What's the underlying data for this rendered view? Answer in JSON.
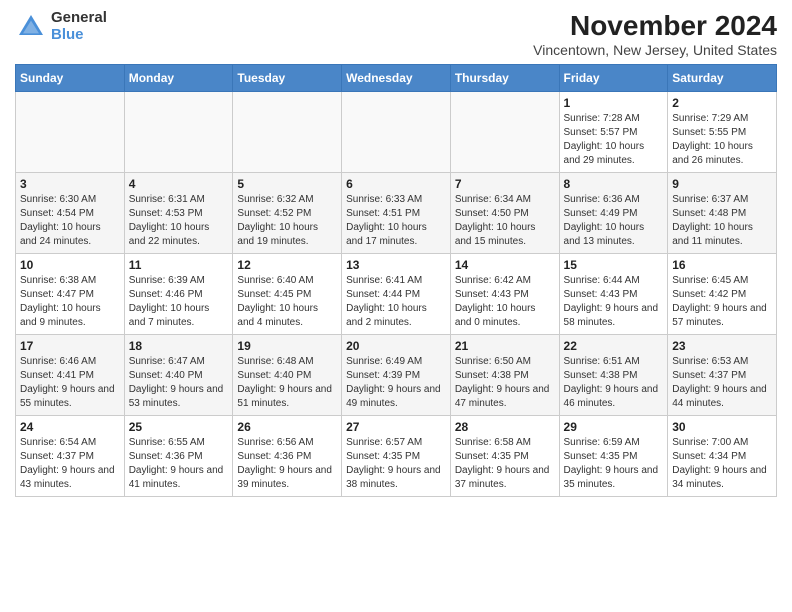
{
  "header": {
    "logo_general": "General",
    "logo_blue": "Blue",
    "title": "November 2024",
    "subtitle": "Vincentown, New Jersey, United States"
  },
  "days_of_week": [
    "Sunday",
    "Monday",
    "Tuesday",
    "Wednesday",
    "Thursday",
    "Friday",
    "Saturday"
  ],
  "weeks": [
    [
      {
        "day": "",
        "info": ""
      },
      {
        "day": "",
        "info": ""
      },
      {
        "day": "",
        "info": ""
      },
      {
        "day": "",
        "info": ""
      },
      {
        "day": "",
        "info": ""
      },
      {
        "day": "1",
        "info": "Sunrise: 7:28 AM\nSunset: 5:57 PM\nDaylight: 10 hours and 29 minutes."
      },
      {
        "day": "2",
        "info": "Sunrise: 7:29 AM\nSunset: 5:55 PM\nDaylight: 10 hours and 26 minutes."
      }
    ],
    [
      {
        "day": "3",
        "info": "Sunrise: 6:30 AM\nSunset: 4:54 PM\nDaylight: 10 hours and 24 minutes."
      },
      {
        "day": "4",
        "info": "Sunrise: 6:31 AM\nSunset: 4:53 PM\nDaylight: 10 hours and 22 minutes."
      },
      {
        "day": "5",
        "info": "Sunrise: 6:32 AM\nSunset: 4:52 PM\nDaylight: 10 hours and 19 minutes."
      },
      {
        "day": "6",
        "info": "Sunrise: 6:33 AM\nSunset: 4:51 PM\nDaylight: 10 hours and 17 minutes."
      },
      {
        "day": "7",
        "info": "Sunrise: 6:34 AM\nSunset: 4:50 PM\nDaylight: 10 hours and 15 minutes."
      },
      {
        "day": "8",
        "info": "Sunrise: 6:36 AM\nSunset: 4:49 PM\nDaylight: 10 hours and 13 minutes."
      },
      {
        "day": "9",
        "info": "Sunrise: 6:37 AM\nSunset: 4:48 PM\nDaylight: 10 hours and 11 minutes."
      }
    ],
    [
      {
        "day": "10",
        "info": "Sunrise: 6:38 AM\nSunset: 4:47 PM\nDaylight: 10 hours and 9 minutes."
      },
      {
        "day": "11",
        "info": "Sunrise: 6:39 AM\nSunset: 4:46 PM\nDaylight: 10 hours and 7 minutes."
      },
      {
        "day": "12",
        "info": "Sunrise: 6:40 AM\nSunset: 4:45 PM\nDaylight: 10 hours and 4 minutes."
      },
      {
        "day": "13",
        "info": "Sunrise: 6:41 AM\nSunset: 4:44 PM\nDaylight: 10 hours and 2 minutes."
      },
      {
        "day": "14",
        "info": "Sunrise: 6:42 AM\nSunset: 4:43 PM\nDaylight: 10 hours and 0 minutes."
      },
      {
        "day": "15",
        "info": "Sunrise: 6:44 AM\nSunset: 4:43 PM\nDaylight: 9 hours and 58 minutes."
      },
      {
        "day": "16",
        "info": "Sunrise: 6:45 AM\nSunset: 4:42 PM\nDaylight: 9 hours and 57 minutes."
      }
    ],
    [
      {
        "day": "17",
        "info": "Sunrise: 6:46 AM\nSunset: 4:41 PM\nDaylight: 9 hours and 55 minutes."
      },
      {
        "day": "18",
        "info": "Sunrise: 6:47 AM\nSunset: 4:40 PM\nDaylight: 9 hours and 53 minutes."
      },
      {
        "day": "19",
        "info": "Sunrise: 6:48 AM\nSunset: 4:40 PM\nDaylight: 9 hours and 51 minutes."
      },
      {
        "day": "20",
        "info": "Sunrise: 6:49 AM\nSunset: 4:39 PM\nDaylight: 9 hours and 49 minutes."
      },
      {
        "day": "21",
        "info": "Sunrise: 6:50 AM\nSunset: 4:38 PM\nDaylight: 9 hours and 47 minutes."
      },
      {
        "day": "22",
        "info": "Sunrise: 6:51 AM\nSunset: 4:38 PM\nDaylight: 9 hours and 46 minutes."
      },
      {
        "day": "23",
        "info": "Sunrise: 6:53 AM\nSunset: 4:37 PM\nDaylight: 9 hours and 44 minutes."
      }
    ],
    [
      {
        "day": "24",
        "info": "Sunrise: 6:54 AM\nSunset: 4:37 PM\nDaylight: 9 hours and 43 minutes."
      },
      {
        "day": "25",
        "info": "Sunrise: 6:55 AM\nSunset: 4:36 PM\nDaylight: 9 hours and 41 minutes."
      },
      {
        "day": "26",
        "info": "Sunrise: 6:56 AM\nSunset: 4:36 PM\nDaylight: 9 hours and 39 minutes."
      },
      {
        "day": "27",
        "info": "Sunrise: 6:57 AM\nSunset: 4:35 PM\nDaylight: 9 hours and 38 minutes."
      },
      {
        "day": "28",
        "info": "Sunrise: 6:58 AM\nSunset: 4:35 PM\nDaylight: 9 hours and 37 minutes."
      },
      {
        "day": "29",
        "info": "Sunrise: 6:59 AM\nSunset: 4:35 PM\nDaylight: 9 hours and 35 minutes."
      },
      {
        "day": "30",
        "info": "Sunrise: 7:00 AM\nSunset: 4:34 PM\nDaylight: 9 hours and 34 minutes."
      }
    ]
  ]
}
